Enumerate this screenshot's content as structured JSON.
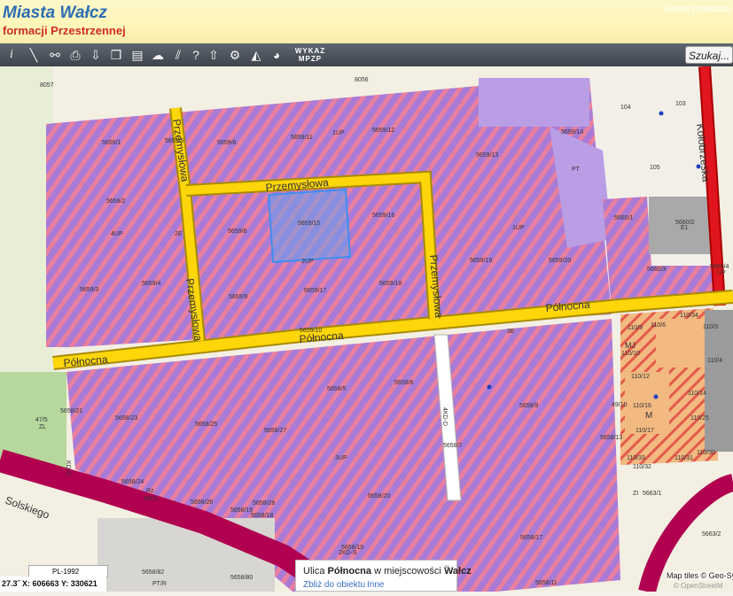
{
  "header": {
    "title": "Miasta Wałcz",
    "subtitle": "formacji Przestrzennej",
    "link": "Serwis prowadzo"
  },
  "toolbar": {
    "icons": [
      "info-icon",
      "measure-line-icon",
      "link-icon",
      "print-icon",
      "download-icon",
      "copy-icon",
      "layout-icon",
      "comment-icon",
      "hatch-icon",
      "help-icon",
      "upload-cloud-icon",
      "settings-icon",
      "layers-icon",
      "chat-icon"
    ],
    "wykaz_line1": "WYKAZ",
    "wykaz_line2": "MPZP",
    "search_label": "Szukaj..."
  },
  "map": {
    "parcels": [
      "8057",
      "8056",
      "5659/1",
      "5659/5",
      "5659/6",
      "5659/11",
      "1UP",
      "5659/12",
      "5659/13",
      "5659/14",
      "PT",
      "104",
      "103",
      "105",
      "5659/2",
      "4UP",
      "2E",
      "5659/8",
      "5659/15",
      "5659/16",
      "1UP",
      "5660/1",
      "5660/2",
      "E1",
      "5659/3",
      "5659/4",
      "5659/9",
      "2UP",
      "5659/17",
      "5659/18",
      "5659/19",
      "5659/20",
      "5660/3",
      "5660/4",
      "5659/10",
      "3E",
      "5658/21",
      "47/5",
      "ZL",
      "5658/23",
      "5658/25",
      "5658/5",
      "5658/6",
      "5658/9",
      "4KD-D",
      "5658/27",
      "5658/7",
      "3UP",
      "5658/24",
      "Rz",
      "49/11",
      "5658/26",
      "5658/28",
      "5658/16",
      "5658/18",
      "5658/20",
      "5658/19",
      "2KD-S",
      "5658/13",
      "5658/17",
      "5658/82",
      "PT/R",
      "5658/80",
      "5663/1",
      "5663/2",
      "5658/11",
      "ZI",
      "49/10",
      "110/9",
      "110/6",
      "110/10",
      "110/34",
      "110/3",
      "110/4",
      "110/12",
      "110/14",
      "110/16",
      "110/25",
      "110/17",
      "110/33",
      "110/32",
      "110/31",
      "110/30",
      "M",
      "MJ",
      "KD-D",
      "UP"
    ],
    "streets": [
      "Przemysłowa",
      "Przemysłowa",
      "Przemysłowa",
      "Przemysłowa",
      "Północna",
      "Północna",
      "Północna",
      "Kołobrzeska",
      "Solskiego"
    ],
    "colors": {
      "plan_zone": "#a97bd6",
      "hatch": "#e97fa0",
      "road": "#ffd60a",
      "road_border": "#a88b00",
      "main_road": "#b0004f",
      "residential": "#f2b980",
      "industrial_pt": "#b99ee6",
      "kolobrzeska": "#e0151f"
    }
  },
  "coords": {
    "crs": "PL-1992",
    "text": "27.3˝ X: 606663 Y: 330621"
  },
  "popup": {
    "prefix": "Ulica ",
    "street": "Północna",
    "middle": " w miejscowości ",
    "city": "Wałcz",
    "zoom_link": "Zbliż do obiektu",
    "other_link": "Inne",
    "close": "×"
  },
  "attribution": {
    "tiles": "Map tiles © Geo-Syst",
    "osm": "© OpenStreetM"
  }
}
